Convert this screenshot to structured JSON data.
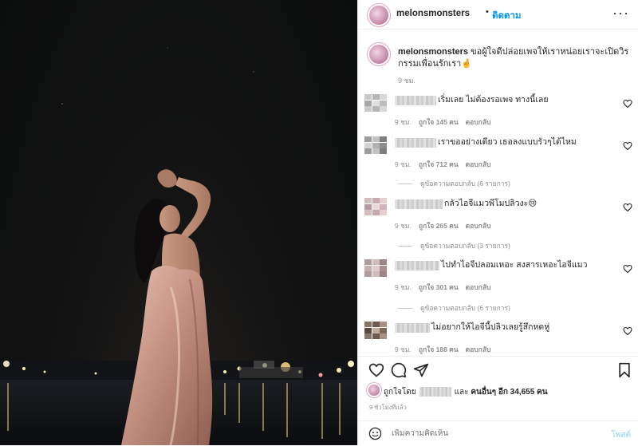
{
  "post": {
    "username": "melonsmonsters",
    "dot": "•",
    "follow_label": "ติดตาม",
    "more_label": "···",
    "caption_text": "ขอผู้ใจดีปล่อยเพจให้เราหน่อยเราจะเปิดวิรกรรมเพื่อนรักเรา🤞",
    "caption_time": "9 ชม."
  },
  "comments": [
    {
      "name_blur_width": 52,
      "text": "เริ่มเลย ไม่ต้องรอเพจ ทางนี้เลย",
      "time": "9 ชม.",
      "likes": "ถูกใจ 145 คน",
      "reply": "ตอบกลับ",
      "view_replies": ""
    },
    {
      "name_blur_width": 52,
      "text": "เราขออย่างเดียว เธอลงแบบรัวๆได้ไหม",
      "time": "9 ชม.",
      "likes": "ถูกใจ 712 คน",
      "reply": "ตอบกลับ",
      "view_replies": "ดูข้อความตอบกลับ (6 รายการ)"
    },
    {
      "name_blur_width": 60,
      "text": "กลัวไอจีแมวพีโมปลิวงะ😢",
      "time": "9 ชม.",
      "likes": "ถูกใจ 265 คน",
      "reply": "ตอบกลับ",
      "view_replies": "ดูข้อความตอบกลับ (3 รายการ)"
    },
    {
      "name_blur_width": 56,
      "text": "ไปทำไอจีปลอมเหอะ สงสารเหอะไอจีแมว",
      "time": "9 ชม.",
      "likes": "ถูกใจ 301 คน",
      "reply": "ตอบกลับ",
      "view_replies": "ดูข้อความตอบกลับ (6 รายการ)"
    },
    {
      "name_blur_width": 44,
      "text": "ไม่อยากให้ไอจีนี้ปลิวเลยรู้สึกหดหู่",
      "time": "9 ชม.",
      "likes": "ถูกใจ 188 คน",
      "reply": "ตอบกลับ",
      "view_replies": ""
    }
  ],
  "likes_summary": {
    "prefix": "ถูกใจโดย",
    "middle": "และ",
    "others": "คนอื่นๆ อีก 34,655 คน"
  },
  "time_ago": "9 ชั่วโมงที่แล้ว",
  "add_comment": {
    "placeholder": "เพิ่มความคิดเห็น",
    "post_label": "โพสต์"
  },
  "icons": {
    "like": "heart-icon",
    "comment": "comment-bubble-icon",
    "share": "paper-plane-icon",
    "save": "bookmark-icon",
    "emoji": "smiley-icon"
  },
  "colors": {
    "link_blue": "#0095f6",
    "muted": "#8e8e8e",
    "text": "#262626",
    "disabled_blue": "#b2dffc"
  }
}
